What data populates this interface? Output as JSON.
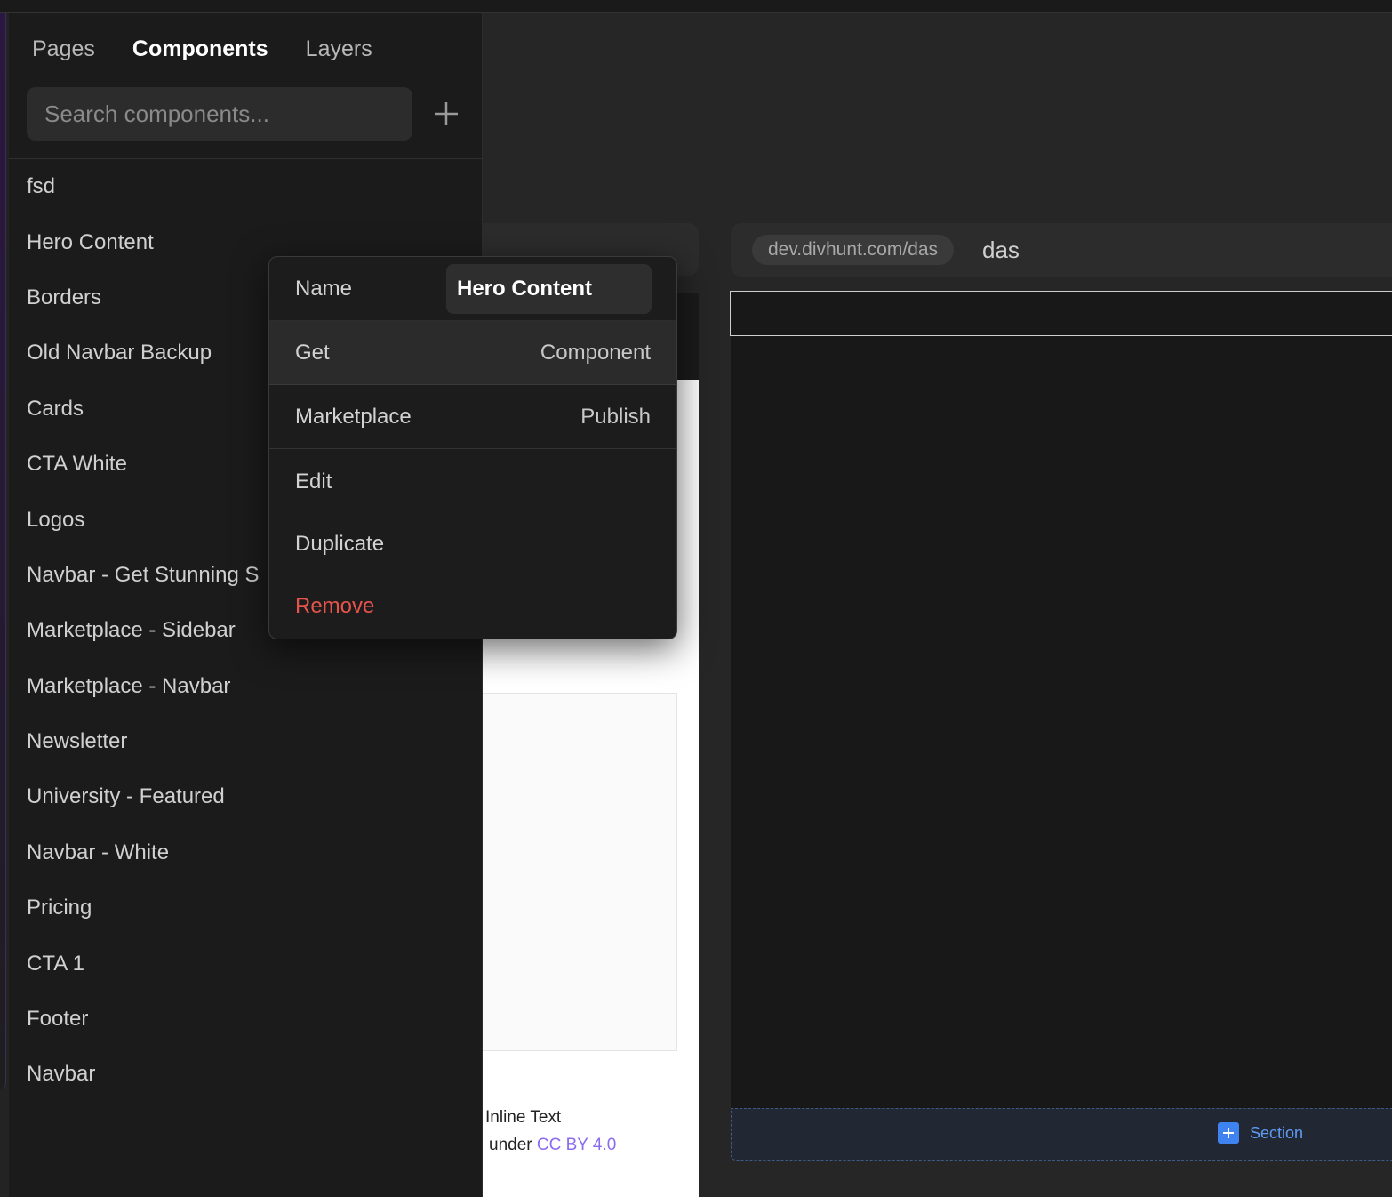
{
  "sidebar": {
    "tabs": [
      {
        "label": "Pages"
      },
      {
        "label": "Components"
      },
      {
        "label": "Layers"
      }
    ],
    "active_tab": "Components",
    "search": {
      "placeholder": "Search components...",
      "value": ""
    },
    "components": [
      "fsd",
      "Hero Content",
      "Borders",
      "Old Navbar Backup",
      "Cards",
      "CTA White",
      "Logos",
      "Navbar - Get Stunning S",
      "Marketplace - Sidebar",
      "Marketplace - Navbar",
      "Newsletter",
      "University - Featured",
      "Navbar - White",
      "Pricing",
      "CTA 1",
      "Footer",
      "Navbar"
    ]
  },
  "context_menu": {
    "name_label": "Name",
    "name_value": "Hero Content",
    "get_label": "Get",
    "get_value": "Component",
    "marketplace_label": "Marketplace",
    "marketplace_value": "Publish",
    "edit_label": "Edit",
    "duplicate_label": "Duplicate",
    "remove_label": "Remove"
  },
  "preview_left": {
    "inline_text": "Inline Text",
    "license_prefix": "under ",
    "license_link": "CC BY 4.0"
  },
  "preview_right": {
    "url": "dev.divhunt.com/das",
    "page_name": "das",
    "section_button": "Section"
  },
  "colors": {
    "accent_blue": "#3e83f0",
    "remove_red": "#e5534b",
    "link_purple": "#8b6bf0"
  }
}
